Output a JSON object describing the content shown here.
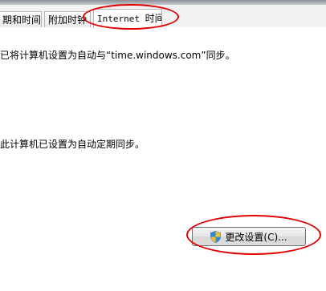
{
  "tabs": [
    {
      "label": "期和时间",
      "active": false
    },
    {
      "label": "附加时钟",
      "active": false
    },
    {
      "label_latin": "Internet",
      "label_cjk": "时间",
      "active": true
    }
  ],
  "content": {
    "sync_status": "已将计算机设置为自动与“time.windows.com”同步。",
    "auto_sync_info": "此计算机已设置为自动定期同步。"
  },
  "change_settings_button": {
    "label": "更改设置(C)...",
    "icon": "uac-shield-icon"
  },
  "annotation_color": "#e00000"
}
